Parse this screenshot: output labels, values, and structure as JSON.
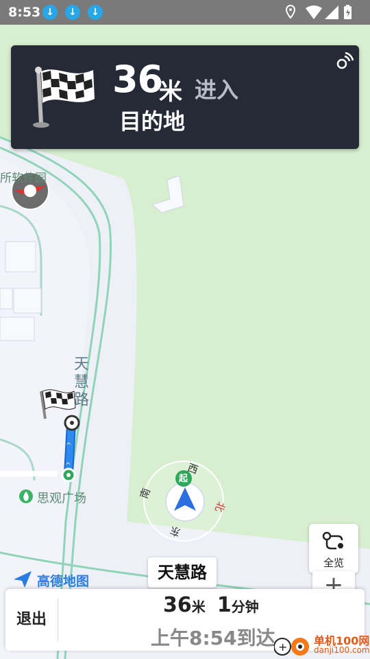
{
  "status_bar": {
    "time": "8:53",
    "download_icons": [
      "download-icon",
      "download-icon",
      "download-icon"
    ],
    "system_icons": [
      "location-icon",
      "wifi-icon",
      "battery-charging-icon"
    ]
  },
  "guidance": {
    "distance": "36",
    "unit": "米",
    "action": "进入",
    "target": "目的地",
    "icon": "checkered-flag-icon",
    "voice_icon": "voice-broadcast-icon"
  },
  "map": {
    "poi_top": "所软件园",
    "poi_plaza": "思观广场",
    "road_name": "天慧路",
    "compass": {
      "north": "北",
      "south": "南",
      "east": "东",
      "west": "西",
      "start": "起"
    },
    "compass_small": "北"
  },
  "overview_button": {
    "label": "全览",
    "icon": "route-overview-icon"
  },
  "zoom": {
    "in": "+",
    "out": "−"
  },
  "street_name": "天慧路",
  "brand": "高德地图",
  "trip": {
    "distance": "36",
    "distance_unit": "米",
    "time": "1",
    "time_unit": "分钟",
    "arrival": "上午8:54到达"
  },
  "exit_label": "退出",
  "watermark": {
    "line1": "单机100网",
    "line2": "danji100.com"
  },
  "colors": {
    "map_background": "#d8efcf",
    "road": "#f3f4fb",
    "guide_card": "#262a36",
    "route_blue": "#2e8af0",
    "start_green": "#2ea85a"
  }
}
